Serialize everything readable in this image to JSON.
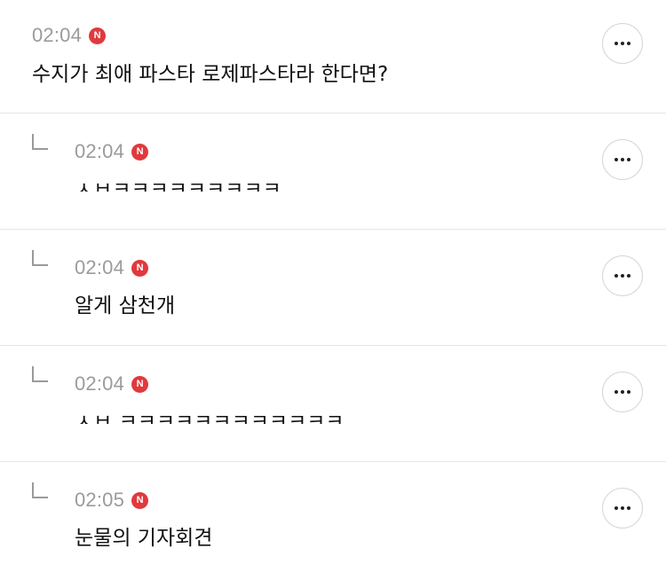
{
  "comments": [
    {
      "time": "02:04",
      "badge": "N",
      "text": "수지가 최애 파스타 로제파스타라 한다면?",
      "is_reply": false
    },
    {
      "time": "02:04",
      "badge": "N",
      "text": "ㅅㅂㅋㅋㅋㅋㅋㅋㅋㅋㅋ",
      "is_reply": true
    },
    {
      "time": "02:04",
      "badge": "N",
      "text": "알게 삼천개",
      "is_reply": true
    },
    {
      "time": "02:04",
      "badge": "N",
      "text": "ㅅㅂ ㅋㅋㅋㅋㅋㅋㅋㅋㅋㅋㅋㅋ",
      "is_reply": true
    },
    {
      "time": "02:05",
      "badge": "N",
      "text": "눈물의 기자회견",
      "is_reply": true
    }
  ],
  "icons": {
    "reply": "reply-arrow-icon",
    "new": "new-badge-icon",
    "more": "more-options-icon"
  },
  "colors": {
    "badge": "#e0393e",
    "time": "#9b9b9b",
    "divider": "#e5e5e5"
  }
}
